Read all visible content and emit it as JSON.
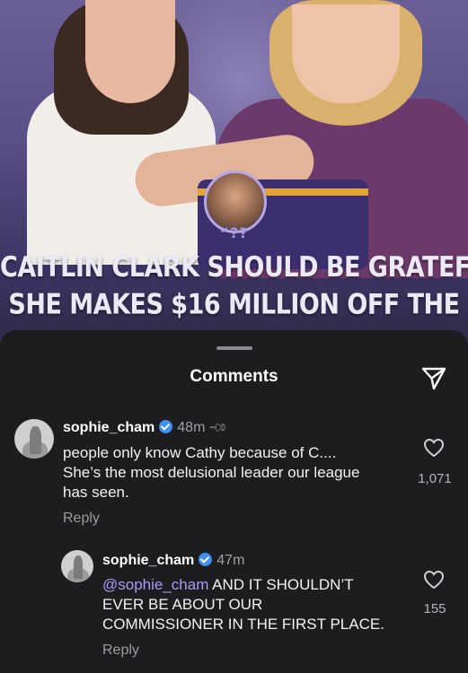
{
  "post": {
    "quote_mark": "“??",
    "headline_lines": [
      "CAITLIN CLARK SHOULD BE GRATEFUL",
      "SHE MAKES $16 MILLION OFF THE"
    ]
  },
  "comments_sheet": {
    "title": "Comments",
    "comments": [
      {
        "username": "sophie_cham",
        "time": "48m",
        "pinned": true,
        "text_lines": [
          "people only know Cathy because of C....",
          "She’s the most delusional leader our league",
          "has seen."
        ],
        "like_count": "1,071",
        "reply_label": "Reply"
      },
      {
        "username": "sophie_cham",
        "time": "47m",
        "mention": "@sophie_cham",
        "text_first_line_rest": " AND IT SHOULDN’T",
        "text_lines": [
          "EVER BE ABOUT OUR",
          "COMMISSIONER IN THE FIRST PLACE."
        ],
        "like_count": "155",
        "reply_label": "Reply"
      }
    ]
  },
  "colors": {
    "sheet_background": "#1d1d1f",
    "verified_badge": "#3d8ff0",
    "mention": "#a99cf5",
    "secondary_text": "#a0a0a5"
  },
  "icons": {
    "share": "paper-plane-icon",
    "like": "heart-outline-icon",
    "pin": "pin-icon",
    "verified": "verified-badge-icon"
  }
}
